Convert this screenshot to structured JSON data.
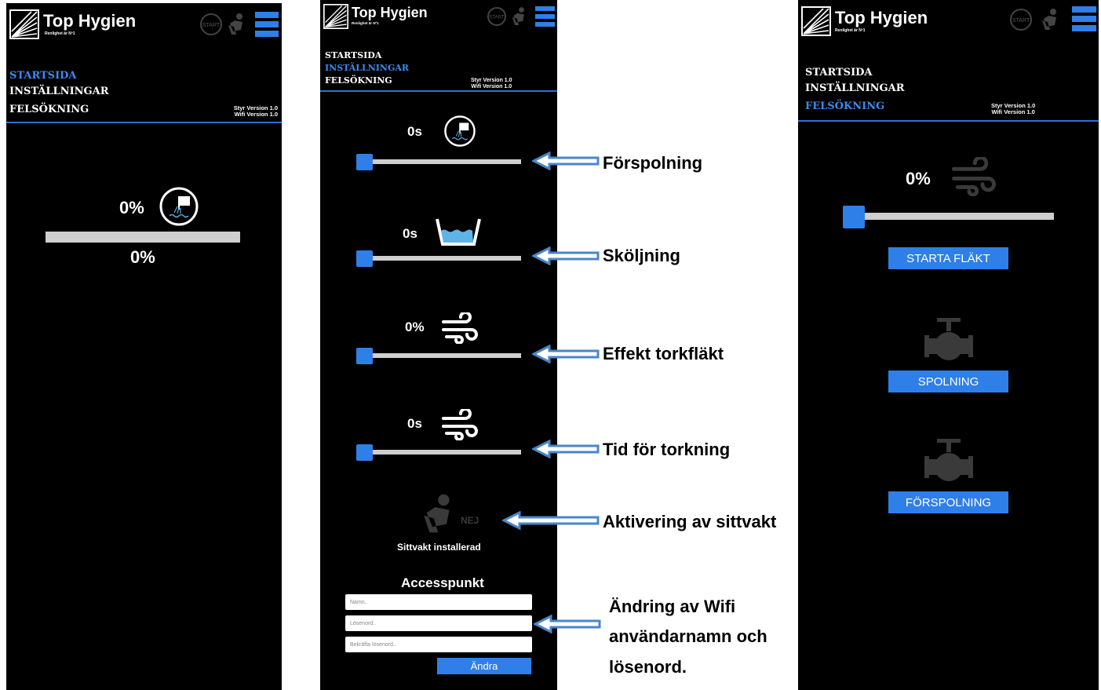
{
  "app": {
    "title": "Top Hygien",
    "subtitle": "Renlighet är Nº1",
    "start_icon_label": "START"
  },
  "nav": {
    "startsida": "STARTSIDA",
    "installningar": "INSTÄLLNINGAR",
    "felsokning": "FELSÖKNING"
  },
  "version": {
    "styr": "Styr Version 1.0",
    "wifi": "Wifi Version 1.0"
  },
  "screen1": {
    "active_nav": "STARTSIDA",
    "percent_top": "0%",
    "percent_bottom": "0%",
    "progress": 0
  },
  "screen2": {
    "active_nav": "INSTÄLLNINGAR",
    "sliders": [
      {
        "value": "0s",
        "icon": "flush-icon",
        "level": 0
      },
      {
        "value": "0s",
        "icon": "water-basin-icon",
        "level": 0
      },
      {
        "value": "0%",
        "icon": "wind-icon",
        "level": 0
      },
      {
        "value": "0s",
        "icon": "wind-icon",
        "level": 0
      }
    ],
    "seat_guard": {
      "state": "NEJ",
      "label": "Sittvakt installerad"
    },
    "access_point": {
      "title": "Accesspunkt",
      "name_placeholder": "Namn..",
      "password_placeholder": "Lösenord..",
      "confirm_placeholder": "Bekräfta lösenord..",
      "button": "Ändra"
    }
  },
  "screen3": {
    "active_nav": "FELSÖKNING",
    "fan_percent": "0%",
    "fan_level": 0,
    "start_fan_button": "STARTA FLÄKT",
    "flush_button": "SPOLNING",
    "preflush_button": "FÖRSPOLNING"
  },
  "callouts": {
    "forspolning": "Förspolning",
    "skoljning": "Sköljning",
    "effekt": "Effekt torkfläkt",
    "tid": "Tid för torkning",
    "aktivering": "Aktivering av sittvakt",
    "wifi_line1": "Ändring av Wifi",
    "wifi_line2": "användarnamn och",
    "wifi_line3": "lösenord."
  },
  "colors": {
    "accent": "#2f7fe8",
    "nav_active": "#3a8cf0",
    "panel_bg": "#000000",
    "arrow": "#4a86c8"
  }
}
